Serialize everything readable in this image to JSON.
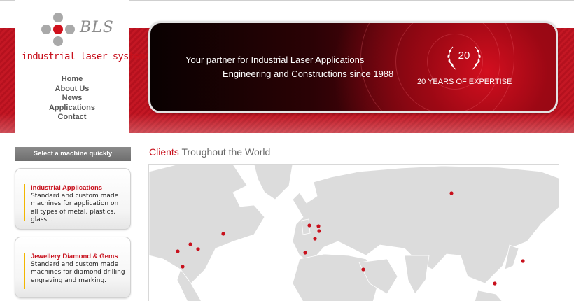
{
  "logo": {
    "short": "BLS",
    "full": "industrial laser systems"
  },
  "nav": [
    {
      "label": "Home"
    },
    {
      "label": "About Us"
    },
    {
      "label": "News"
    },
    {
      "label": "Applications"
    },
    {
      "label": "Contact"
    }
  ],
  "hero": {
    "line1": "Your partner for Industrial Laser Applications",
    "line2": "Engineering and Constructions since 1988",
    "badge_number": "20",
    "badge_caption": "20 YEARS OF EXPERTISE"
  },
  "sidebar": {
    "select_label": "Select a machine quickly",
    "cards": [
      {
        "title": "Industrial Applications",
        "description": "Standard and custom made machines for application on all types of metal, plastics, glass..."
      },
      {
        "title": "Jewellery Diamond & Gems",
        "description": "Standard and custom made machines for diamond drilling engraving and marking."
      }
    ]
  },
  "clients": {
    "title_red": "Clients",
    "title_rest": "Troughout the World"
  },
  "colors": {
    "brand_red": "#c8101c",
    "band_red": "#c41724",
    "land_gray": "#dcdcdc"
  }
}
